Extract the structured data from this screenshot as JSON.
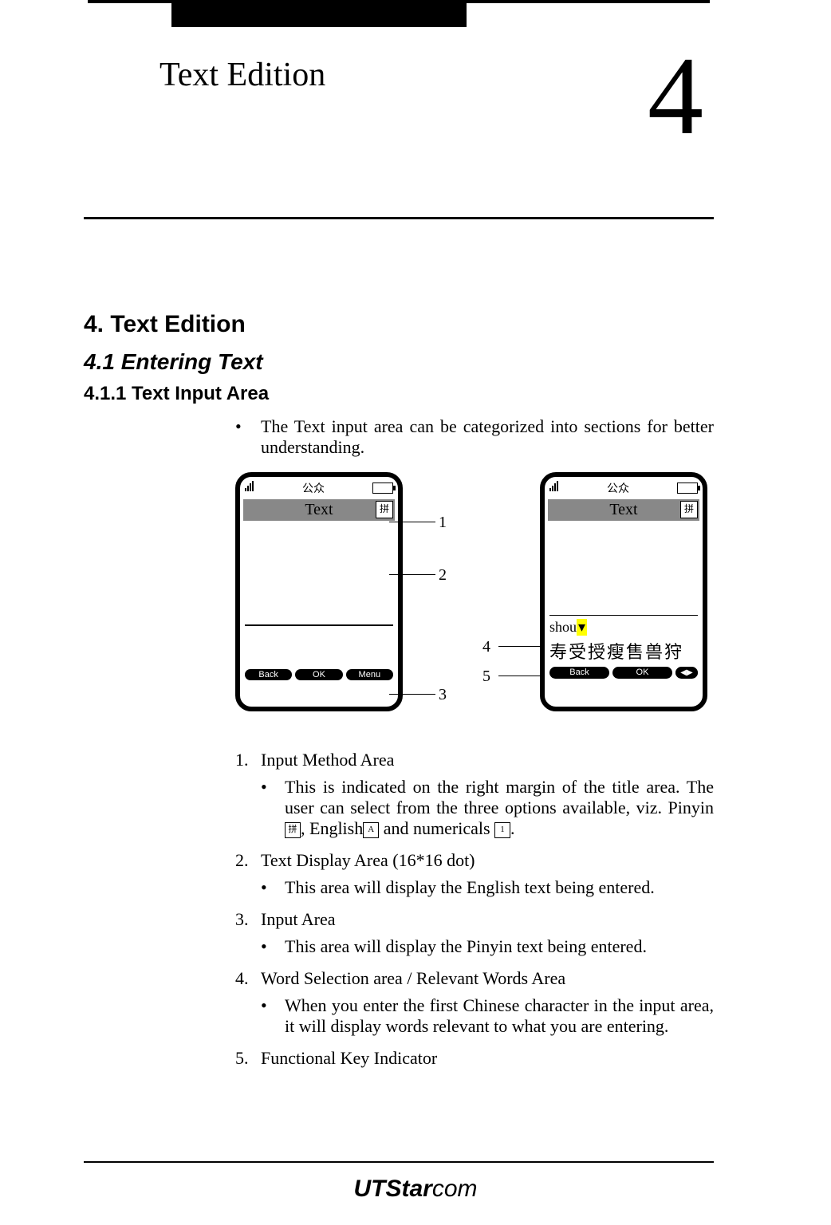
{
  "chapter": {
    "title": "Text Edition",
    "number": "4"
  },
  "headings": {
    "h1": "4. Text Edition",
    "h2": "4.1   Entering Text",
    "h3": "4.1.1 Text Input Area"
  },
  "intro_bullet": "The Text input area can be categorized into sections for better understanding.",
  "phone": {
    "status_net": "公众",
    "title": "Text",
    "mode_glyph": "拼",
    "input": "shou",
    "cursor": "▾",
    "word_candidates": "寿受授瘦售兽狩",
    "softkeys_left": [
      "Back",
      "OK",
      "Menu"
    ],
    "softkeys_right": [
      "Back",
      "OK"
    ]
  },
  "callouts": {
    "c1": "1",
    "c2": "2",
    "c3": "3",
    "c4": "4",
    "c5": "5"
  },
  "list": {
    "i1": {
      "n": "1.",
      "label": "Input Method Area",
      "sub": "This is indicated on the right margin of the title area. The user can select from the three options available, viz. Pinyin",
      "sub_mid": ", English",
      "sub_tail": " and numericals",
      "sub_end": "."
    },
    "i2": {
      "n": "2.",
      "label": "Text Display Area (16*16 dot)",
      "sub": "This area will display the English text being entered."
    },
    "i3": {
      "n": "3.",
      "label": "Input Area",
      "sub": "This area will display the Pinyin text being entered."
    },
    "i4": {
      "n": "4.",
      "label": "Word Selection area / Relevant Words Area",
      "sub": "When you enter the first Chinese character in the input area, it will display words relevant to what you are entering."
    },
    "i5": {
      "n": "5.",
      "label": "Functional Key Indicator"
    }
  },
  "icons": {
    "pinyin": "拼",
    "english": "A",
    "num": "1"
  },
  "logo": {
    "bold": "UTStar",
    "light": "com"
  }
}
